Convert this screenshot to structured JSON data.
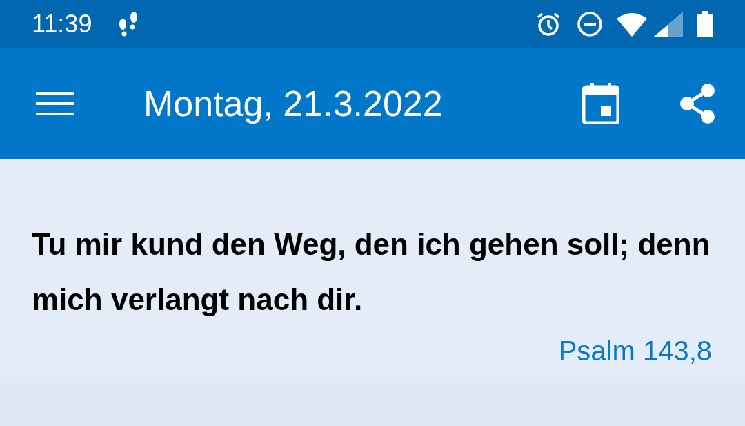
{
  "status_bar": {
    "time": "11:39"
  },
  "app_bar": {
    "title": "Montag, 21.3.2022"
  },
  "verse": {
    "text": "Tu mir kund den Weg, den ich gehen soll; denn mich verlangt nach dir.",
    "reference": "Psalm 143,8"
  }
}
